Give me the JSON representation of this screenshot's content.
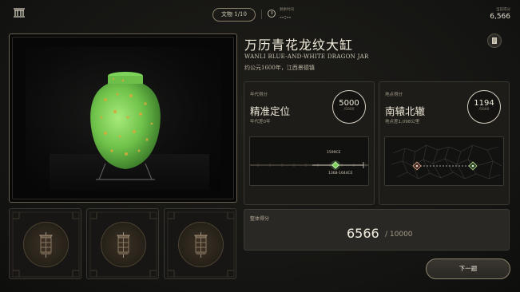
{
  "topbar": {
    "artifact_counter": "文物  1/10",
    "time_label": "剩余时间",
    "time_value": "--:--",
    "score_label": "当前得分",
    "score_value": "6,566"
  },
  "artifact": {
    "title": "万历青花龙纹大缸",
    "english_name": "WANLI BLUE-AND-WHITE DRAGON JAR",
    "meta": "约公元1600年，江西景德镇"
  },
  "era_card": {
    "label": "年代得分",
    "result": "精准定位",
    "detail": "年代差0年",
    "score": "5000",
    "score_max": "/5000",
    "guess_label": "1599CE",
    "range_label": "1368-1644CE"
  },
  "location_card": {
    "label": "地点得分",
    "result": "南辕北辙",
    "detail": "地点差1,098公里",
    "score": "1194",
    "score_max": "/5000"
  },
  "total": {
    "label": "整体得分",
    "score": "6566",
    "max": "/ 10000"
  },
  "next_button": "下一题",
  "colors": {
    "accent_green": "#7ed35a",
    "ring_border": "#d8d0c0",
    "background": "#141412"
  },
  "icons": [
    "museum-icon",
    "clock-icon",
    "zoom-icon",
    "document-icon",
    "lantern-icon"
  ]
}
